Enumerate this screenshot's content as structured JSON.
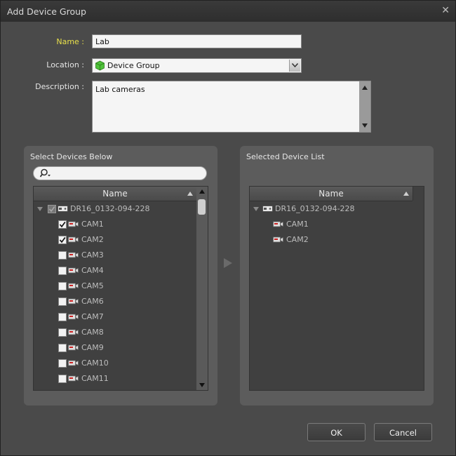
{
  "window": {
    "title": "Add Device Group"
  },
  "form": {
    "name_label": "Name :",
    "name_value": "Lab",
    "location_label": "Location :",
    "location_value": "Device Group",
    "description_label": "Description :",
    "description_value": "Lab cameras"
  },
  "left_panel": {
    "title": "Select Devices Below",
    "column_header": "Name",
    "device": "DR16_0132-094-228",
    "cameras": [
      {
        "label": "CAM1",
        "checked": true
      },
      {
        "label": "CAM2",
        "checked": true
      },
      {
        "label": "CAM3",
        "checked": false
      },
      {
        "label": "CAM4",
        "checked": false
      },
      {
        "label": "CAM5",
        "checked": false
      },
      {
        "label": "CAM6",
        "checked": false
      },
      {
        "label": "CAM7",
        "checked": false
      },
      {
        "label": "CAM8",
        "checked": false
      },
      {
        "label": "CAM9",
        "checked": false
      },
      {
        "label": "CAM10",
        "checked": false
      },
      {
        "label": "CAM11",
        "checked": false
      }
    ]
  },
  "right_panel": {
    "title": "Selected Device List",
    "column_header": "Name",
    "device": "DR16_0132-094-228",
    "cameras": [
      "CAM1",
      "CAM2"
    ]
  },
  "buttons": {
    "ok": "OK",
    "cancel": "Cancel"
  },
  "colors": {
    "name_label": "#e8e04a",
    "background": "#4a4a4a",
    "panel": "#5c5c5c",
    "grid": "#404040"
  }
}
